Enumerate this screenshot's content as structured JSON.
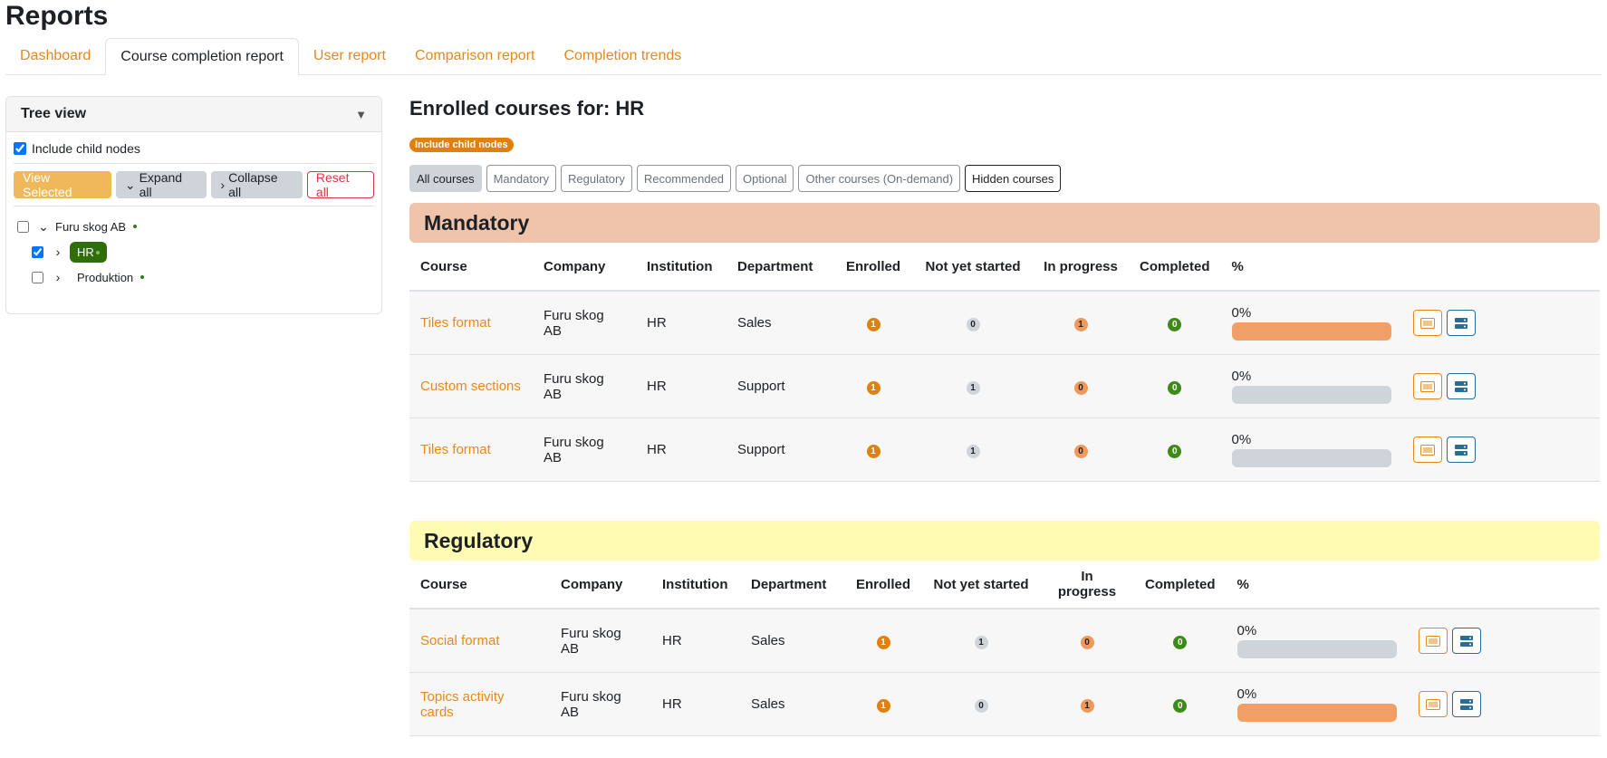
{
  "page": {
    "title": "Reports"
  },
  "tabs": [
    {
      "label": "Dashboard"
    },
    {
      "label": "Course completion report"
    },
    {
      "label": "User report"
    },
    {
      "label": "Comparison report"
    },
    {
      "label": "Completion trends"
    }
  ],
  "active_tab": "Course completion report",
  "tree": {
    "title": "Tree view",
    "include_child_label": "Include child nodes",
    "include_child_checked": true,
    "buttons": {
      "view_selected": "View Selected",
      "expand_all": "Expand all",
      "collapse_all": "Collapse all",
      "reset_all": "Reset all"
    },
    "nodes": [
      {
        "label": "Furu skog AB",
        "checked": false,
        "expanded": true
      },
      {
        "label": "HR",
        "checked": true,
        "expanded": false,
        "selected": true
      },
      {
        "label": "Produktion",
        "checked": false,
        "expanded": false
      }
    ]
  },
  "main": {
    "heading": "Enrolled courses for: HR",
    "include_child_badge": "Include child nodes",
    "filters": [
      {
        "label": "All courses"
      },
      {
        "label": "Mandatory"
      },
      {
        "label": "Regulatory"
      },
      {
        "label": "Recommended"
      },
      {
        "label": "Optional"
      },
      {
        "label": "Other courses (On-demand)"
      },
      {
        "label": "Hidden courses"
      }
    ],
    "active_filter": "All courses",
    "columns": [
      "Course",
      "Company",
      "Institution",
      "Department",
      "Enrolled",
      "Not yet started",
      "In progress",
      "Completed",
      "%"
    ],
    "sections": [
      {
        "title": "Mandatory",
        "color": "#f0c4ab",
        "rows": [
          {
            "course": "Tiles format",
            "company": "Furu skog AB",
            "institution": "HR",
            "department": "Sales",
            "enrolled": "1",
            "not_started": "0",
            "in_progress": "1",
            "completed": "0",
            "percent": "0%",
            "bar_fraction": 1.0
          },
          {
            "course": "Custom sections",
            "company": "Furu skog AB",
            "institution": "HR",
            "department": "Support",
            "enrolled": "1",
            "not_started": "1",
            "in_progress": "0",
            "completed": "0",
            "percent": "0%",
            "bar_fraction": 0.0
          },
          {
            "course": "Tiles format",
            "company": "Furu skog AB",
            "institution": "HR",
            "department": "Support",
            "enrolled": "1",
            "not_started": "1",
            "in_progress": "0",
            "completed": "0",
            "percent": "0%",
            "bar_fraction": 0.0
          }
        ]
      },
      {
        "title": "Regulatory",
        "color": "#fdfcb2",
        "rows": [
          {
            "course": "Social format",
            "company": "Furu skog AB",
            "institution": "HR",
            "department": "Sales",
            "enrolled": "1",
            "not_started": "1",
            "in_progress": "0",
            "completed": "0",
            "percent": "0%",
            "bar_fraction": 0.0
          },
          {
            "course": "Topics activity cards",
            "company": "Furu skog AB",
            "institution": "HR",
            "department": "Sales",
            "enrolled": "1",
            "not_started": "0",
            "in_progress": "1",
            "completed": "0",
            "percent": "0%",
            "bar_fraction": 1.0
          }
        ]
      }
    ]
  }
}
